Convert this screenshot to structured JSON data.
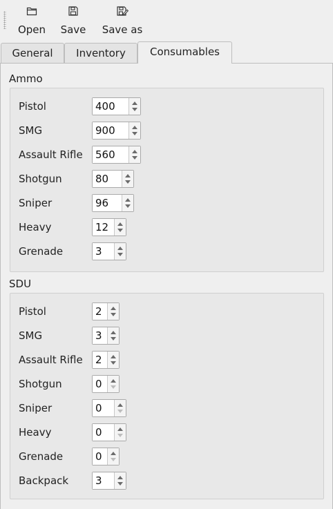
{
  "toolbar": {
    "open_label": "Open",
    "save_label": "Save",
    "saveas_label": "Save as",
    "open_icon": "folder-open-icon",
    "save_icon": "floppy-disk-icon",
    "saveas_icon": "floppy-edit-icon"
  },
  "tabs": [
    {
      "label": "General",
      "active": false
    },
    {
      "label": "Inventory",
      "active": false
    },
    {
      "label": "Consumables",
      "active": true
    }
  ],
  "ammo": {
    "title": "Ammo",
    "rows": [
      {
        "label": "Pistol",
        "value": "400"
      },
      {
        "label": "SMG",
        "value": "900"
      },
      {
        "label": "Assault Rifle",
        "value": "560"
      },
      {
        "label": "Shotgun",
        "value": "80"
      },
      {
        "label": "Sniper",
        "value": "96"
      },
      {
        "label": "Heavy",
        "value": "12"
      },
      {
        "label": "Grenade",
        "value": "3"
      }
    ]
  },
  "sdu": {
    "title": "SDU",
    "rows": [
      {
        "label": "Pistol",
        "value": "2"
      },
      {
        "label": "SMG",
        "value": "3"
      },
      {
        "label": "Assault Rifle",
        "value": "2"
      },
      {
        "label": "Shotgun",
        "value": "0"
      },
      {
        "label": "Sniper",
        "value": "0"
      },
      {
        "label": "Heavy",
        "value": "0"
      },
      {
        "label": "Grenade",
        "value": "0"
      },
      {
        "label": "Backpack",
        "value": "3"
      }
    ]
  }
}
